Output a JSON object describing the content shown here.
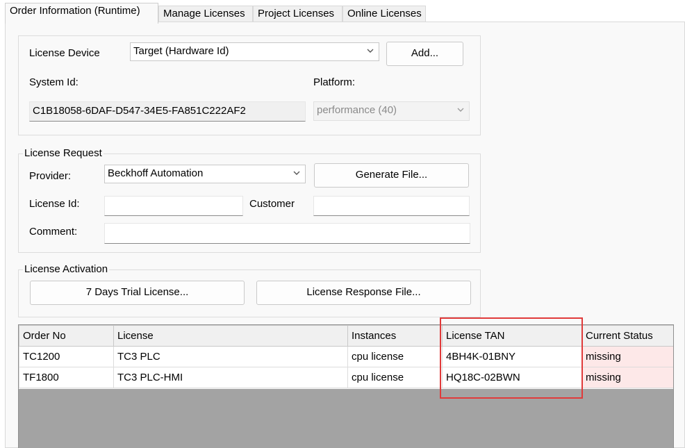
{
  "tabs": [
    {
      "label": "Order Information (Runtime)",
      "active": true
    },
    {
      "label": "Manage Licenses",
      "active": false
    },
    {
      "label": "Project Licenses",
      "active": false
    },
    {
      "label": "Online Licenses",
      "active": false
    }
  ],
  "device": {
    "label": "License Device",
    "selected": "Target (Hardware Id)",
    "add_button": "Add...",
    "system_id_label": "System Id:",
    "system_id_value": "C1B18058-6DAF-D547-34E5-FA851C222AF2",
    "platform_label": "Platform:",
    "platform_value": "performance (40)"
  },
  "license_request": {
    "title": "License Request",
    "provider_label": "Provider:",
    "provider_value": "Beckhoff Automation",
    "generate_button": "Generate File...",
    "license_id_label": "License Id:",
    "license_id_value": "",
    "customer_label": "Customer",
    "customer_value": "",
    "comment_label": "Comment:",
    "comment_value": ""
  },
  "license_activation": {
    "title": "License Activation",
    "trial_button": "7 Days Trial License...",
    "response_button": "License Response File..."
  },
  "grid": {
    "columns": [
      "Order No",
      "License",
      "Instances",
      "License TAN",
      "Current Status"
    ],
    "rows": [
      [
        "TC1200",
        "TC3 PLC",
        "cpu license",
        "4BH4K-01BNY",
        "missing"
      ],
      [
        "TF1800",
        "TC3 PLC-HMI",
        "cpu license",
        "HQ18C-02BWN",
        "missing"
      ]
    ]
  },
  "colors": {
    "highlight": "#e03a3a",
    "status_missing_bg": "#fde8e8",
    "grid_empty_area": "#a3a3a3"
  },
  "icons": [
    "chevron-down-icon"
  ]
}
